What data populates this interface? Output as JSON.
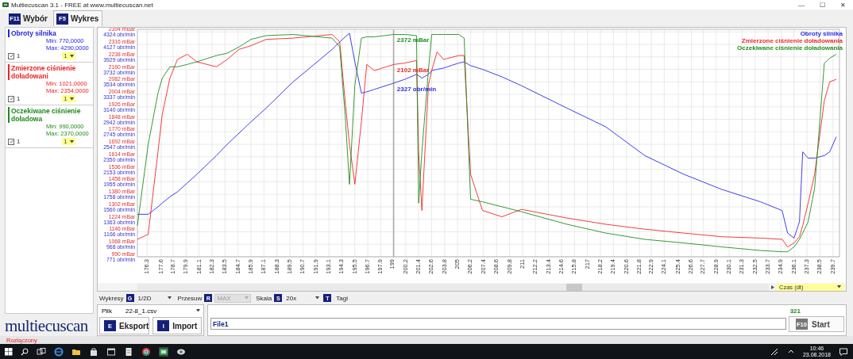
{
  "window": {
    "title": "Multiecuscan 3.1 - FREE at www.multiecuscan.net",
    "controls": [
      "—",
      "☐",
      "✕"
    ]
  },
  "tabs": [
    {
      "key": "F11",
      "label": "Wybór",
      "selected": false
    },
    {
      "key": "F5",
      "label": "Wykres",
      "selected": true
    }
  ],
  "sensors": [
    {
      "name": "Obroty silnika",
      "color": "#2424e0",
      "min": "Min: 770,0000",
      "max": "Max: 4290,0000",
      "checked": true,
      "check_label": "1",
      "dropdown": "1"
    },
    {
      "name": "Zmierzone ciśnienie doładowani",
      "color": "#ee2222",
      "min": "Min: 1021,0000",
      "max": "Max: 2354,0000",
      "checked": true,
      "check_label": "1",
      "dropdown": "1"
    },
    {
      "name": "Oczekiwane ciśnienie doładowa",
      "color": "#1f8a1f",
      "min": "Min: 990,0000",
      "max": "Max: 2370,0000",
      "checked": true,
      "check_label": "1",
      "dropdown": "1"
    }
  ],
  "logo": "multiecuscan",
  "chart": {
    "axis_selector": "Czas (dt)",
    "chart_data": {
      "type": "line",
      "xlim": [
        175.4,
        240.3
      ],
      "ylim": [
        990,
        2410
      ],
      "y2lim": [
        770.9,
        4365
      ],
      "x": [
        175.4,
        176.4,
        177.3,
        177.7,
        178.4,
        179.1,
        180.0,
        180.9,
        182.7,
        183.7,
        184.8,
        185.9,
        187.3,
        189.8,
        193.4,
        194.1,
        194.6,
        195.0,
        195.5,
        196.1,
        196.6,
        197.3,
        199.1,
        200.1,
        201.2,
        201.4,
        201.7,
        202.3,
        202.6,
        203.1,
        203.7,
        205.1,
        205.6,
        206.2,
        207.3,
        209.1,
        210.9,
        215.1,
        218.7,
        222.3,
        225.9,
        229.4,
        233.0,
        235.0,
        235.5,
        236.1,
        236.6,
        236.9,
        237.4,
        238.0,
        238.9,
        239.4,
        240.0
      ],
      "series": [
        {
          "name": "Obroty silnika",
          "color": "#2a2ae8",
          "axis": "y2",
          "values": [
            1442,
            1442,
            1560,
            1620,
            1718,
            1797,
            1936,
            2074,
            2370,
            2548,
            2725,
            2903,
            3120,
            3535,
            4048,
            4166,
            4245,
            4304,
            3850,
            3357,
            3377,
            3416,
            3515,
            3574,
            3653,
            3633,
            3594,
            3653,
            3712,
            3732,
            3752,
            3831,
            3850,
            3791,
            3732,
            3614,
            3475,
            3120,
            2824,
            2370,
            2074,
            1837,
            1639,
            1501,
            1146,
            1067,
            1324,
            2429,
            2330,
            2330,
            2370,
            2429,
            2666
          ]
        },
        {
          "name": "Zmierzone ciśnienie doładowania",
          "color": "#f02828",
          "values": [
            1099,
            1130,
            1645,
            1879,
            2105,
            2222,
            2254,
            2207,
            2176,
            2222,
            2285,
            2308,
            2347,
            2355,
            2378,
            2332,
            1965,
            1692,
            1442,
            1832,
            2191,
            2152,
            2191,
            2199,
            2215,
            1645,
            1279,
            2059,
            2152,
            2269,
            2222,
            2246,
            2246,
            1505,
            1279,
            1240,
            1286,
            1232,
            1193,
            1162,
            1138,
            1115,
            1107,
            1099,
            1052,
            1076,
            1115,
            1185,
            1325,
            1505,
            1965,
            2082,
            2098
          ]
        },
        {
          "name": "Oczekiwane ciśnienie doładowania",
          "color": "#1f8f1f",
          "values": [
            1185,
            1692,
            2012,
            2105,
            2176,
            2176,
            2191,
            2207,
            2246,
            2261,
            2300,
            2347,
            2371,
            2378,
            2355,
            2300,
            1879,
            1442,
            2059,
            2355,
            2363,
            2363,
            2378,
            2378,
            2371,
            1325,
            1645,
            2152,
            2378,
            2378,
            2378,
            2378,
            2355,
            1349,
            1333,
            1302,
            1271,
            1193,
            1138,
            1099,
            1076,
            1052,
            1029,
            1021,
            1021,
            1052,
            1099,
            1138,
            1208,
            1419,
            2199,
            2230,
            2254
          ]
        }
      ],
      "xticks": [
        176.3,
        177.6,
        178.7,
        179.9,
        181.1,
        182.3,
        183.5,
        184.7,
        185.9,
        187.1,
        188.3,
        189.5,
        190.7,
        191.9,
        193.1,
        194.3,
        195.5,
        196.7,
        197.9,
        199.0,
        200.2,
        201.4,
        202.6,
        203.8,
        205.0,
        206.2,
        207.4,
        208.6,
        209.8,
        211.0,
        212.2,
        213.4,
        214.6,
        215.8,
        217.0,
        218.2,
        219.4,
        220.6,
        221.8,
        222.9,
        224.1,
        225.4,
        226.6,
        227.7,
        228.9,
        230.1,
        231.3,
        232.5,
        233.7,
        234.9,
        236.1,
        237.3,
        238.5,
        239.7
      ],
      "yticks": [
        {
          "value": 990,
          "label": "990 mBar"
        },
        {
          "value": 1068,
          "label": "1068 mBar"
        },
        {
          "value": 1146,
          "label": "1146 mBar"
        },
        {
          "value": 1224,
          "label": "1224 mBar"
        },
        {
          "value": 1302,
          "label": "1302 mBar"
        },
        {
          "value": 1380,
          "label": "1380 mBar"
        },
        {
          "value": 1458,
          "label": "1458 mBar"
        },
        {
          "value": 1536,
          "label": "1536 mBar"
        },
        {
          "value": 1614,
          "label": "1614 mBar"
        },
        {
          "value": 1692,
          "label": "1692 mBar"
        },
        {
          "value": 1770,
          "label": "1770 mBar"
        },
        {
          "value": 1848,
          "label": "1848 mBar"
        },
        {
          "value": 1926,
          "label": "1926 mBar"
        },
        {
          "value": 2004,
          "label": "2004 mBar"
        },
        {
          "value": 2082,
          "label": "2082 mBar"
        },
        {
          "value": 2160,
          "label": "2160 mBar"
        },
        {
          "value": 2238,
          "label": "2238 mBar"
        },
        {
          "value": 2316,
          "label": "2316 mBar"
        },
        {
          "value": 2394,
          "label": "2394 mBar"
        }
      ],
      "y2ticks": [
        {
          "value": 771,
          "label": "771 obr/min"
        },
        {
          "value": 968,
          "label": "968 obr/min"
        },
        {
          "value": 1166,
          "label": "1166 obr/min"
        },
        {
          "value": 1363,
          "label": "1363 obr/min"
        },
        {
          "value": 1560,
          "label": "1560 obr/min"
        },
        {
          "value": 1758,
          "label": "1758 obr/min"
        },
        {
          "value": 1955,
          "label": "1955 obr/min"
        },
        {
          "value": 2153,
          "label": "2153 obr/min"
        },
        {
          "value": 2350,
          "label": "2350 obr/min"
        },
        {
          "value": 2547,
          "label": "2547 obr/min"
        },
        {
          "value": 2745,
          "label": "2745 obr/min"
        },
        {
          "value": 2942,
          "label": "2942 obr/min"
        },
        {
          "value": 3140,
          "label": "3140 obr/min"
        },
        {
          "value": 3337,
          "label": "3337 obr/min"
        },
        {
          "value": 3534,
          "label": "3534 obr/min"
        },
        {
          "value": 3732,
          "label": "3732 obr/min"
        },
        {
          "value": 3929,
          "label": "3929 obr/min"
        },
        {
          "value": 4127,
          "label": "4127 obr/min"
        },
        {
          "value": 4324,
          "label": "4324 obr/min"
        }
      ],
      "grid": true,
      "ref_lines": [
        {
          "axis": "x",
          "value": 199.1
        }
      ]
    },
    "cursor_readings": [
      {
        "text": "2372 mBar",
        "color": "#1f8f1f"
      },
      {
        "text": "2102 mBar",
        "color": "#f02828"
      },
      {
        "text": "2327 obr/min",
        "color": "#2a2ae8"
      }
    ]
  },
  "toolbar": [
    {
      "kind": "dropdown",
      "label": "Wykresy",
      "key": "G",
      "value": "1/2D",
      "disabled": false
    },
    {
      "kind": "dropdown",
      "label": "Przesuw",
      "key": "R",
      "value": "MAX",
      "disabled": true
    },
    {
      "kind": "dropdown",
      "label": "Skala",
      "key": "S",
      "value": "20x",
      "disabled": false
    },
    {
      "kind": "toggle",
      "label": "Tagi",
      "key": "T"
    }
  ],
  "file_panel": {
    "label": "Plik",
    "value": "22-8_1.csv",
    "buttons": [
      {
        "key": "E",
        "label": "Eksport"
      },
      {
        "key": "I",
        "label": "Import"
      }
    ]
  },
  "run_panel": {
    "count": "321",
    "file_name": "File1",
    "start": {
      "key": "F10",
      "label": "Start"
    }
  },
  "status_bar": "Rozłączony",
  "taskbar": {
    "time": "10:46",
    "date": "23.08.2018"
  }
}
